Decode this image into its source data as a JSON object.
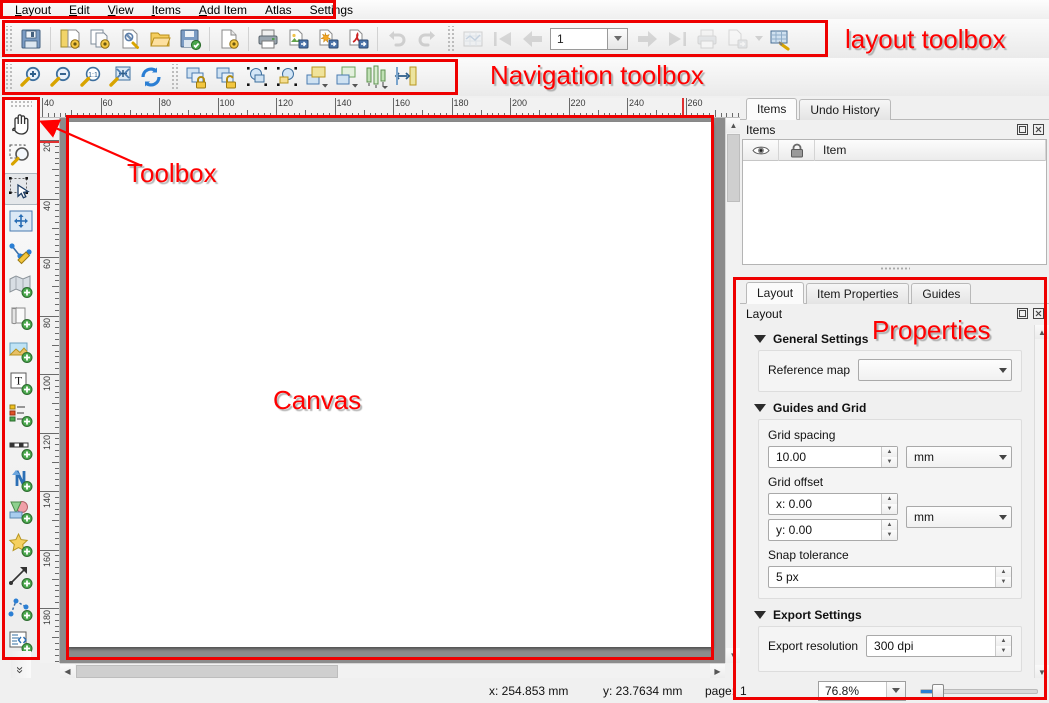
{
  "menu": {
    "items": [
      {
        "label": "Layout",
        "accel": "L"
      },
      {
        "label": "Edit",
        "accel": "E"
      },
      {
        "label": "View",
        "accel": "V"
      },
      {
        "label": "Items",
        "accel": "I"
      },
      {
        "label": "Add Item",
        "accel": "A"
      },
      {
        "label": "Atlas",
        "accel": ""
      },
      {
        "label": "Settings",
        "accel": ""
      }
    ]
  },
  "layout_toolbar": {
    "buttons": [
      {
        "name": "save-project",
        "tip": "Save Project"
      },
      {
        "name": "new-layout",
        "tip": "New Layout"
      },
      {
        "name": "duplicate-layout",
        "tip": "Duplicate Layout"
      },
      {
        "name": "layout-manager",
        "tip": "Layout Manager"
      },
      {
        "name": "open-template",
        "tip": "Add Items from Template"
      },
      {
        "name": "save-template",
        "tip": "Save as Template"
      },
      {
        "name": "new-report",
        "tip": "New Report"
      },
      {
        "name": "print-layout",
        "tip": "Print Layout"
      },
      {
        "name": "export-image",
        "tip": "Export as Image"
      },
      {
        "name": "export-svg",
        "tip": "Export as SVG"
      },
      {
        "name": "export-pdf",
        "tip": "Export as PDF"
      },
      {
        "name": "undo",
        "tip": "Undo"
      },
      {
        "name": "redo",
        "tip": "Redo"
      }
    ],
    "atlas": {
      "preview_tip": "Preview Atlas",
      "first_tip": "First Feature",
      "prev_tip": "Previous Feature",
      "page_value": "1",
      "next_tip": "Next Feature",
      "last_tip": "Last Feature",
      "print_tip": "Print Atlas",
      "export_tip": "Export Atlas",
      "settings_tip": "Atlas Settings"
    }
  },
  "nav_toolbar": {
    "buttons": [
      {
        "name": "zoom-in",
        "tip": "Zoom In"
      },
      {
        "name": "zoom-out",
        "tip": "Zoom Out"
      },
      {
        "name": "zoom-full",
        "tip": "Zoom 100%"
      },
      {
        "name": "zoom-to-extent",
        "tip": "Zoom Full"
      },
      {
        "name": "refresh-view",
        "tip": "Refresh View"
      },
      {
        "name": "lock-items",
        "tip": "Lock Selected Items"
      },
      {
        "name": "unlock-items",
        "tip": "Unlock All Items"
      },
      {
        "name": "group-items",
        "tip": "Group Items"
      },
      {
        "name": "ungroup-items",
        "tip": "Ungroup Items"
      },
      {
        "name": "raise-items",
        "tip": "Raise Selected Items"
      },
      {
        "name": "lower-items",
        "tip": "Lower Selected Items"
      },
      {
        "name": "align-items",
        "tip": "Align Selected Items"
      },
      {
        "name": "distribute-items",
        "tip": "Distribute Items"
      }
    ]
  },
  "toolbox": {
    "tools": [
      {
        "name": "pan-layout",
        "tip": "Pan Layout"
      },
      {
        "name": "zoom-tool",
        "tip": "Zoom"
      },
      {
        "name": "select-item",
        "tip": "Select/Move Item",
        "active": true
      },
      {
        "name": "move-item-content",
        "tip": "Move Item Content"
      },
      {
        "name": "edit-nodes",
        "tip": "Edit Nodes Item"
      },
      {
        "name": "add-map",
        "tip": "Add Map"
      },
      {
        "name": "add-picture",
        "tip": "Add Picture"
      },
      {
        "name": "add-image",
        "tip": "Add Image"
      },
      {
        "name": "add-label",
        "tip": "Add Label"
      },
      {
        "name": "add-legend",
        "tip": "Add Legend"
      },
      {
        "name": "add-scalebar",
        "tip": "Add Scale Bar"
      },
      {
        "name": "add-north-arrow",
        "tip": "Add North Arrow"
      },
      {
        "name": "add-shape",
        "tip": "Add Shape"
      },
      {
        "name": "add-marker",
        "tip": "Add Marker"
      },
      {
        "name": "add-arrow",
        "tip": "Add Arrow"
      },
      {
        "name": "add-node-item",
        "tip": "Add Node Item"
      },
      {
        "name": "add-html",
        "tip": "Add HTML"
      }
    ],
    "overflow_glyph": "»"
  },
  "rulers": {
    "horizontal": {
      "labels": [
        "40",
        "60",
        "80",
        "100",
        "120",
        "140",
        "160",
        "180",
        "200",
        "220",
        "240",
        "260"
      ],
      "unit": "mm"
    },
    "vertical": {
      "labels": [
        "20",
        "40",
        "60",
        "80",
        "100",
        "120",
        "140",
        "160",
        "180"
      ],
      "unit": "mm"
    }
  },
  "items_dock": {
    "tabs": [
      {
        "label": "Items",
        "selected": true
      },
      {
        "label": "Undo History",
        "selected": false
      }
    ],
    "title": "Items",
    "columns": [
      "",
      "",
      "Item"
    ],
    "column_icons": [
      "eye-icon",
      "lock-icon"
    ],
    "rows": []
  },
  "properties_dock": {
    "tabs": [
      {
        "label": "Layout",
        "selected": true
      },
      {
        "label": "Item Properties",
        "selected": false
      },
      {
        "label": "Guides",
        "selected": false
      }
    ],
    "title": "Layout",
    "groups": [
      {
        "name": "general-settings",
        "label": "General Settings",
        "fields": [
          {
            "name": "reference-map",
            "label": "Reference map",
            "type": "combo",
            "value": ""
          }
        ]
      },
      {
        "name": "guides-and-grid",
        "label": "Guides and Grid",
        "fields": [
          {
            "name": "grid-spacing",
            "label": "Grid spacing",
            "type": "spin",
            "value": "10.00",
            "unit": "mm"
          },
          {
            "name": "grid-offset",
            "label": "Grid offset",
            "type": "spin-pair",
            "value_x": "x: 0.00",
            "value_y": "y: 0.00",
            "unit": "mm"
          },
          {
            "name": "snap-tolerance",
            "label": "Snap tolerance",
            "type": "spin",
            "value": "5 px"
          }
        ]
      },
      {
        "name": "export-settings",
        "label": "Export Settings",
        "fields": [
          {
            "name": "export-resolution",
            "label": "Export resolution",
            "type": "spin",
            "value": "300 dpi"
          }
        ]
      }
    ]
  },
  "statusbar": {
    "x_label": "x: 254.853 mm",
    "y_label": "y: 23.7634 mm",
    "page_label": "page:",
    "page_value": "1",
    "zoom_value": "76.8%"
  },
  "annotations": {
    "layout_toolbox": "layout toolbox",
    "navigation_toolbox": "Navigation toolbox",
    "toolbox": "Toolbox",
    "canvas": "Canvas",
    "properties": "Properties",
    "color": "#ff0000"
  }
}
